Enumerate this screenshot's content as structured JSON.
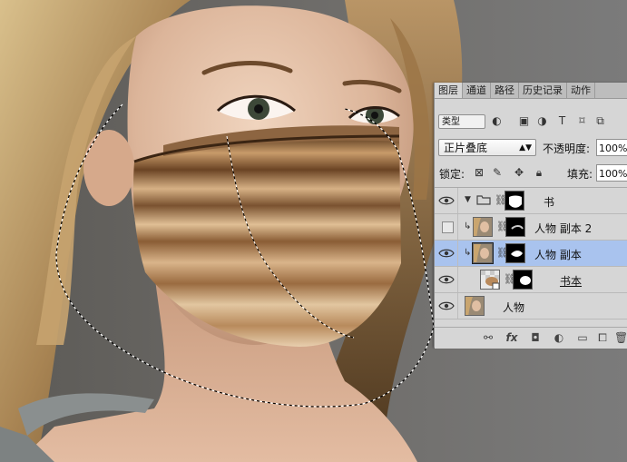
{
  "panel": {
    "tabs": [
      "图层",
      "通道",
      "路径",
      "历史记录",
      "动作"
    ],
    "filter": {
      "value": "类型"
    },
    "blend_mode": "正片叠底",
    "opacity_label": "不透明度:",
    "opacity_value": "100%",
    "lock_label": "锁定:",
    "fill_label": "填充:",
    "fill_value": "100%",
    "layers": [
      {
        "name": "书",
        "visible": true,
        "type": "group"
      },
      {
        "name": "人物 副本 2",
        "visible": false,
        "type": "clipped"
      },
      {
        "name": "人物 副本",
        "visible": true,
        "type": "clipped",
        "selected": true
      },
      {
        "name": "书本",
        "visible": true,
        "type": "smart-object"
      },
      {
        "name": "人物",
        "visible": true,
        "type": "pixel"
      }
    ],
    "bottom_icons": [
      "link-icon",
      "fx-icon",
      "mask-icon",
      "adjustment-icon",
      "group-icon",
      "new-layer-icon",
      "trash-icon"
    ]
  },
  "colors": {
    "selection": "#a9c3ee",
    "panel_bg": "#d6d6d6",
    "canvas_bg": "#6d6d6d"
  }
}
